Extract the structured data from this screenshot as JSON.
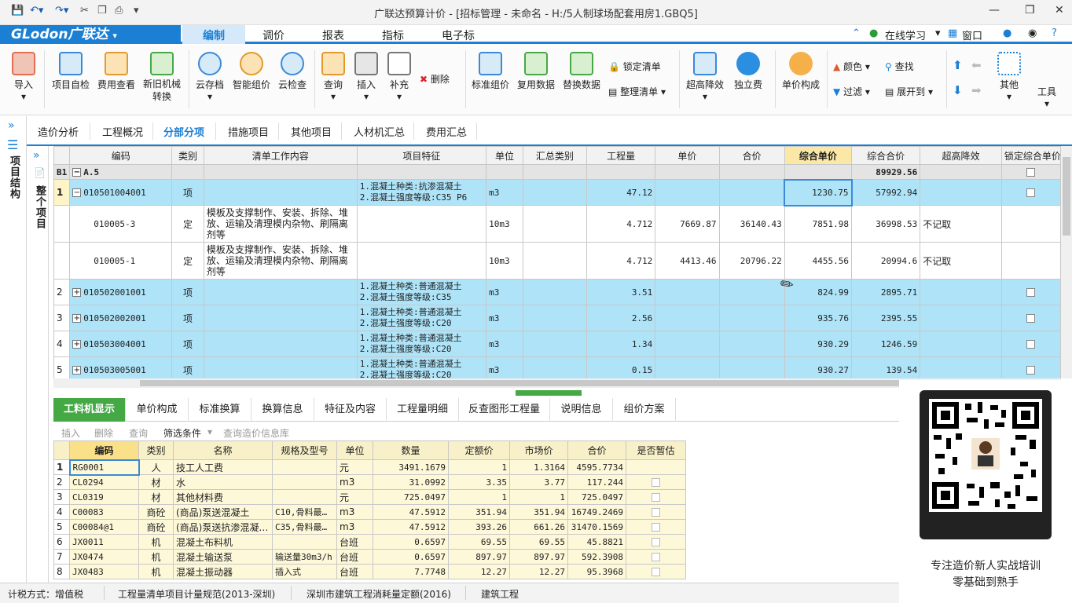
{
  "window": {
    "title": "广联达预算计价 - [招标管理 - 未命名 - H:/5人制球场配套用房1.GBQ5]"
  },
  "menubar": {
    "logo": "GLodon广联达",
    "items": [
      "编制",
      "调价",
      "报表",
      "指标",
      "电子标"
    ],
    "active": "编制",
    "right": {
      "learn": "在线学习",
      "window": "窗口"
    }
  },
  "ribbon": {
    "buttons": [
      "导入",
      "项目自检",
      "费用查看",
      "新旧机械转换",
      "云存档",
      "智能组价",
      "云检查",
      "查询",
      "插入",
      "补充",
      "标准组价",
      "复用数据",
      "替换数据",
      "超高降效",
      "独立费",
      "单价构成",
      "其他",
      "工具"
    ],
    "small": {
      "delete": "删除",
      "lock": "锁定清单",
      "tidy": "整理清单",
      "color": "颜色",
      "find": "查找",
      "filter": "过滤",
      "expand": "展开到"
    }
  },
  "leftnav": {
    "title": "项目结构",
    "sub": "整个项目"
  },
  "tabs": [
    "造价分析",
    "工程概况",
    "分部分项",
    "措施项目",
    "其他项目",
    "人材机汇总",
    "费用汇总"
  ],
  "active_tab": "分部分项",
  "grid": {
    "headers": [
      "编码",
      "类别",
      "清单工作内容",
      "项目特征",
      "单位",
      "汇总类别",
      "工程量",
      "单价",
      "合价",
      "综合单价",
      "综合合价",
      "超高降效",
      "锁定综合单价"
    ],
    "rows": [
      {
        "no": "B1",
        "code": "A.5",
        "type": "",
        "work": "",
        "feature": "",
        "unit": "",
        "qty": "",
        "price": "",
        "total": "",
        "cprice": "",
        "ctotal": "89929.56",
        "eff": ""
      },
      {
        "no": "1",
        "code": "010501004001",
        "type": "项",
        "work": "",
        "feature": "1.混凝土种类:抗渗混凝土\n2.混凝土强度等级:C35 P6",
        "unit": "m3",
        "qty": "47.12",
        "price": "",
        "total": "",
        "cprice": "1230.75",
        "ctotal": "57992.94",
        "eff": ""
      },
      {
        "no": "",
        "code": "010005-3",
        "type": "定",
        "work": "模板及支撑制作、安装、拆除、堆放、运输及清理模内杂物、刷隔离剂等",
        "feature": "",
        "unit": "10m3",
        "qty": "4.712",
        "price": "7669.87",
        "total": "36140.43",
        "cprice": "7851.98",
        "ctotal": "36998.53",
        "eff": "不记取"
      },
      {
        "no": "",
        "code": "010005-1",
        "type": "定",
        "work": "模板及支撑制作、安装、拆除、堆放、运输及清理模内杂物、刷隔离剂等",
        "feature": "",
        "unit": "10m3",
        "qty": "4.712",
        "price": "4413.46",
        "total": "20796.22",
        "cprice": "4455.56",
        "ctotal": "20994.6",
        "eff": "不记取"
      },
      {
        "no": "2",
        "code": "010502001001",
        "type": "项",
        "work": "",
        "feature": "1.混凝土种类:普通混凝土\n2.混凝土强度等级:C35",
        "unit": "m3",
        "qty": "3.51",
        "price": "",
        "total": "",
        "cprice": "824.99",
        "ctotal": "2895.71",
        "eff": ""
      },
      {
        "no": "3",
        "code": "010502002001",
        "type": "项",
        "work": "",
        "feature": "1.混凝土种类:普通混凝土\n2.混凝土强度等级:C20",
        "unit": "m3",
        "qty": "2.56",
        "price": "",
        "total": "",
        "cprice": "935.76",
        "ctotal": "2395.55",
        "eff": ""
      },
      {
        "no": "4",
        "code": "010503004001",
        "type": "项",
        "work": "",
        "feature": "1.混凝土种类:普通混凝土\n2.混凝土强度等级:C20",
        "unit": "m3",
        "qty": "1.34",
        "price": "",
        "total": "",
        "cprice": "930.29",
        "ctotal": "1246.59",
        "eff": ""
      },
      {
        "no": "5",
        "code": "010503005001",
        "type": "项",
        "work": "",
        "feature": "1.混凝土种类:普通混凝土\n2.混凝土强度等级:C20",
        "unit": "m3",
        "qty": "0.15",
        "price": "",
        "total": "",
        "cprice": "930.27",
        "ctotal": "139.54",
        "eff": ""
      }
    ]
  },
  "bottom_tabs": [
    "工料机显示",
    "单价构成",
    "标准换算",
    "换算信息",
    "特征及内容",
    "工程量明细",
    "反查图形工程量",
    "说明信息",
    "组价方案"
  ],
  "bottom_toolbar": {
    "insert": "插入",
    "delete": "删除",
    "query": "查询",
    "filter": "筛选条件",
    "query_price": "查询造价信息库"
  },
  "bottom_grid": {
    "headers": [
      "编码",
      "类别",
      "名称",
      "规格及型号",
      "单位",
      "数量",
      "定额价",
      "市场价",
      "合价",
      "是否暂估"
    ],
    "rows": [
      {
        "no": "1",
        "code": "RG0001",
        "type": "人",
        "name": "技工人工费",
        "spec": "",
        "unit": "元",
        "qty": "3491.1679",
        "quota": "1",
        "market": "1.3164",
        "total": "4595.7734"
      },
      {
        "no": "2",
        "code": "CL0294",
        "type": "材",
        "name": "水",
        "spec": "",
        "unit": "m3",
        "qty": "31.0992",
        "quota": "3.35",
        "market": "3.77",
        "total": "117.244"
      },
      {
        "no": "3",
        "code": "CL0319",
        "type": "材",
        "name": "其他材料费",
        "spec": "",
        "unit": "元",
        "qty": "725.0497",
        "quota": "1",
        "market": "1",
        "total": "725.0497"
      },
      {
        "no": "4",
        "code": "C00083",
        "type": "商砼",
        "name": "(商品)泵送混凝土",
        "spec": "C10,骨料最…",
        "unit": "m3",
        "qty": "47.5912",
        "quota": "351.94",
        "market": "351.94",
        "total": "16749.2469"
      },
      {
        "no": "5",
        "code": "C00084@1",
        "type": "商砼",
        "name": "(商品)泵送抗渗混凝…",
        "spec": "C35,骨料最…",
        "unit": "m3",
        "qty": "47.5912",
        "quota": "393.26",
        "market": "661.26",
        "total": "31470.1569"
      },
      {
        "no": "6",
        "code": "JX0011",
        "type": "机",
        "name": "混凝土布料机",
        "spec": "",
        "unit": "台班",
        "qty": "0.6597",
        "quota": "69.55",
        "market": "69.55",
        "total": "45.8821"
      },
      {
        "no": "7",
        "code": "JX0474",
        "type": "机",
        "name": "混凝土输送泵",
        "spec": "输送量30m3/h",
        "unit": "台班",
        "qty": "0.6597",
        "quota": "897.97",
        "market": "897.97",
        "total": "592.3908"
      },
      {
        "no": "8",
        "code": "JX0483",
        "type": "机",
        "name": "混凝土振动器",
        "spec": "插入式",
        "unit": "台班",
        "qty": "7.7748",
        "quota": "12.27",
        "market": "12.27",
        "total": "95.3968"
      }
    ]
  },
  "status": {
    "tax": "计税方式：增值税",
    "norm": "工程量清单项目计量规范(2013-深圳)",
    "quota": "深圳市建筑工程消耗量定额(2016)",
    "type": "建筑工程"
  },
  "promo": {
    "line1": "专注造价新人实战培训",
    "line2": "零基础到熟手"
  },
  "colors": {
    "accent": "#1b7fd4",
    "row_blue": "#aee3f8",
    "active_green": "#44a845"
  }
}
